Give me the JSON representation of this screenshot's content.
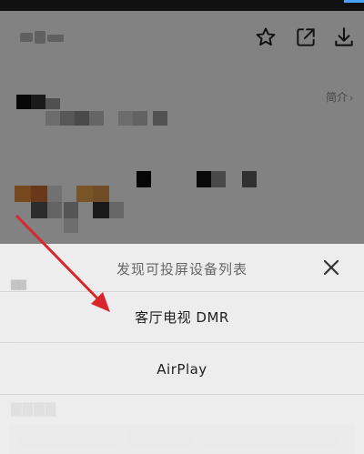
{
  "background": {
    "intro_link": "简介",
    "intro_chevron": "›"
  },
  "sheet": {
    "title": "发现可投屏设备列表",
    "devices": [
      {
        "label": "客厅电视 DMR"
      },
      {
        "label": "AirPlay"
      }
    ]
  },
  "icons": {
    "favorite": "star-outline-icon",
    "share": "share-external-icon",
    "download": "download-icon",
    "close": "close-x-icon"
  },
  "colors": {
    "annotation_arrow": "#d9262e",
    "sheet_background": "#ffffff",
    "overlay": "rgba(0,0,0,0.48)",
    "title_text": "#666666",
    "item_text": "#1f1f1f"
  }
}
